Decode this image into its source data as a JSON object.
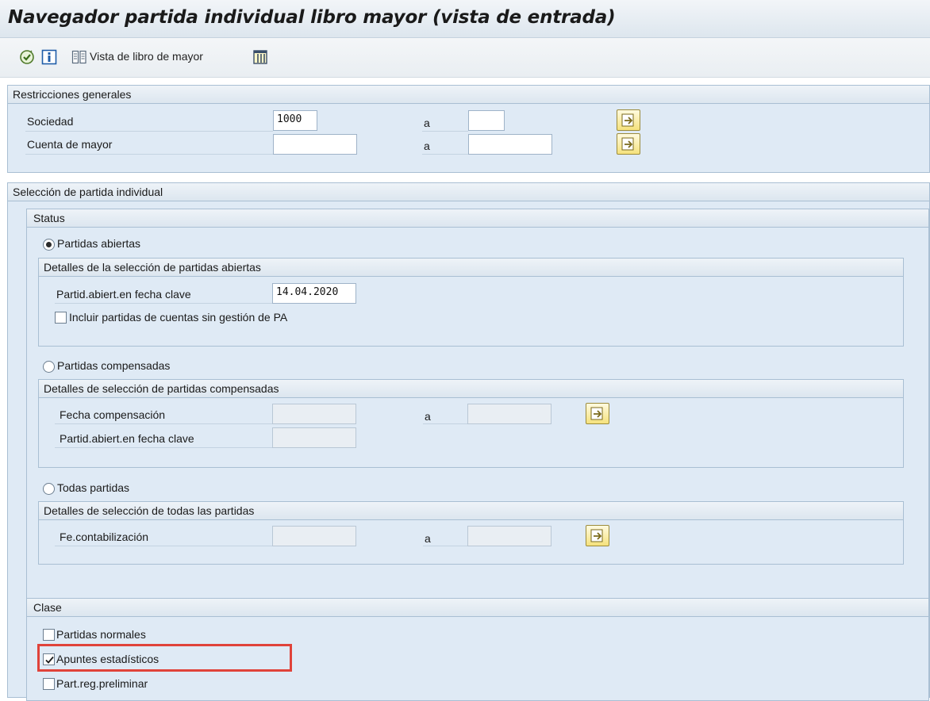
{
  "title": "Navegador partida individual libro mayor (vista de entrada)",
  "toolbar": {
    "execute_icon": "execute-icon",
    "info_icon": "info-icon",
    "ledger_view_label": "Vista de libro de mayor",
    "layout_icon": "layout-icon"
  },
  "general": {
    "heading": "Restricciones generales",
    "sociedad_label": "Sociedad",
    "sociedad_value": "1000",
    "sociedad_to_label": "a",
    "sociedad_to_value": "",
    "cuenta_label": "Cuenta de mayor",
    "cuenta_value": "",
    "cuenta_to_label": "a",
    "cuenta_to_value": ""
  },
  "seleccion": {
    "heading": "Selección de partida individual",
    "status": {
      "heading": "Status",
      "abiertas": {
        "radio_label": "Partidas abiertas",
        "selected": true,
        "details_heading": "Detalles de la selección de partidas abiertas",
        "fecha_clave_label": "Partid.abiert.en fecha clave",
        "fecha_clave_value": "14.04.2020",
        "incluir_label": "Incluir partidas de cuentas sin gestión de PA",
        "incluir_checked": false
      },
      "compensadas": {
        "radio_label": "Partidas compensadas",
        "selected": false,
        "details_heading": "Detalles de selección de partidas compensadas",
        "fecha_comp_label": "Fecha compensación",
        "fecha_comp_to_label": "a",
        "fecha_clave_label": "Partid.abiert.en fecha clave"
      },
      "todas": {
        "radio_label": "Todas partidas",
        "selected": false,
        "details_heading": "Detalles de selección de todas las partidas",
        "fe_contab_label": "Fe.contabilización",
        "fe_contab_to_label": "a"
      }
    },
    "clase": {
      "heading": "Clase",
      "normales_label": "Partidas normales",
      "normales_checked": false,
      "estadisticos_label": "Apuntes estadísticos",
      "estadisticos_checked": true,
      "preliminar_label": "Part.reg.preliminar",
      "preliminar_checked": false
    }
  },
  "colors": {
    "panel_bg": "#dfeaf5",
    "border": "#a9bfd3",
    "highlight": "#e0433a",
    "select_button": "#f5e27c"
  }
}
